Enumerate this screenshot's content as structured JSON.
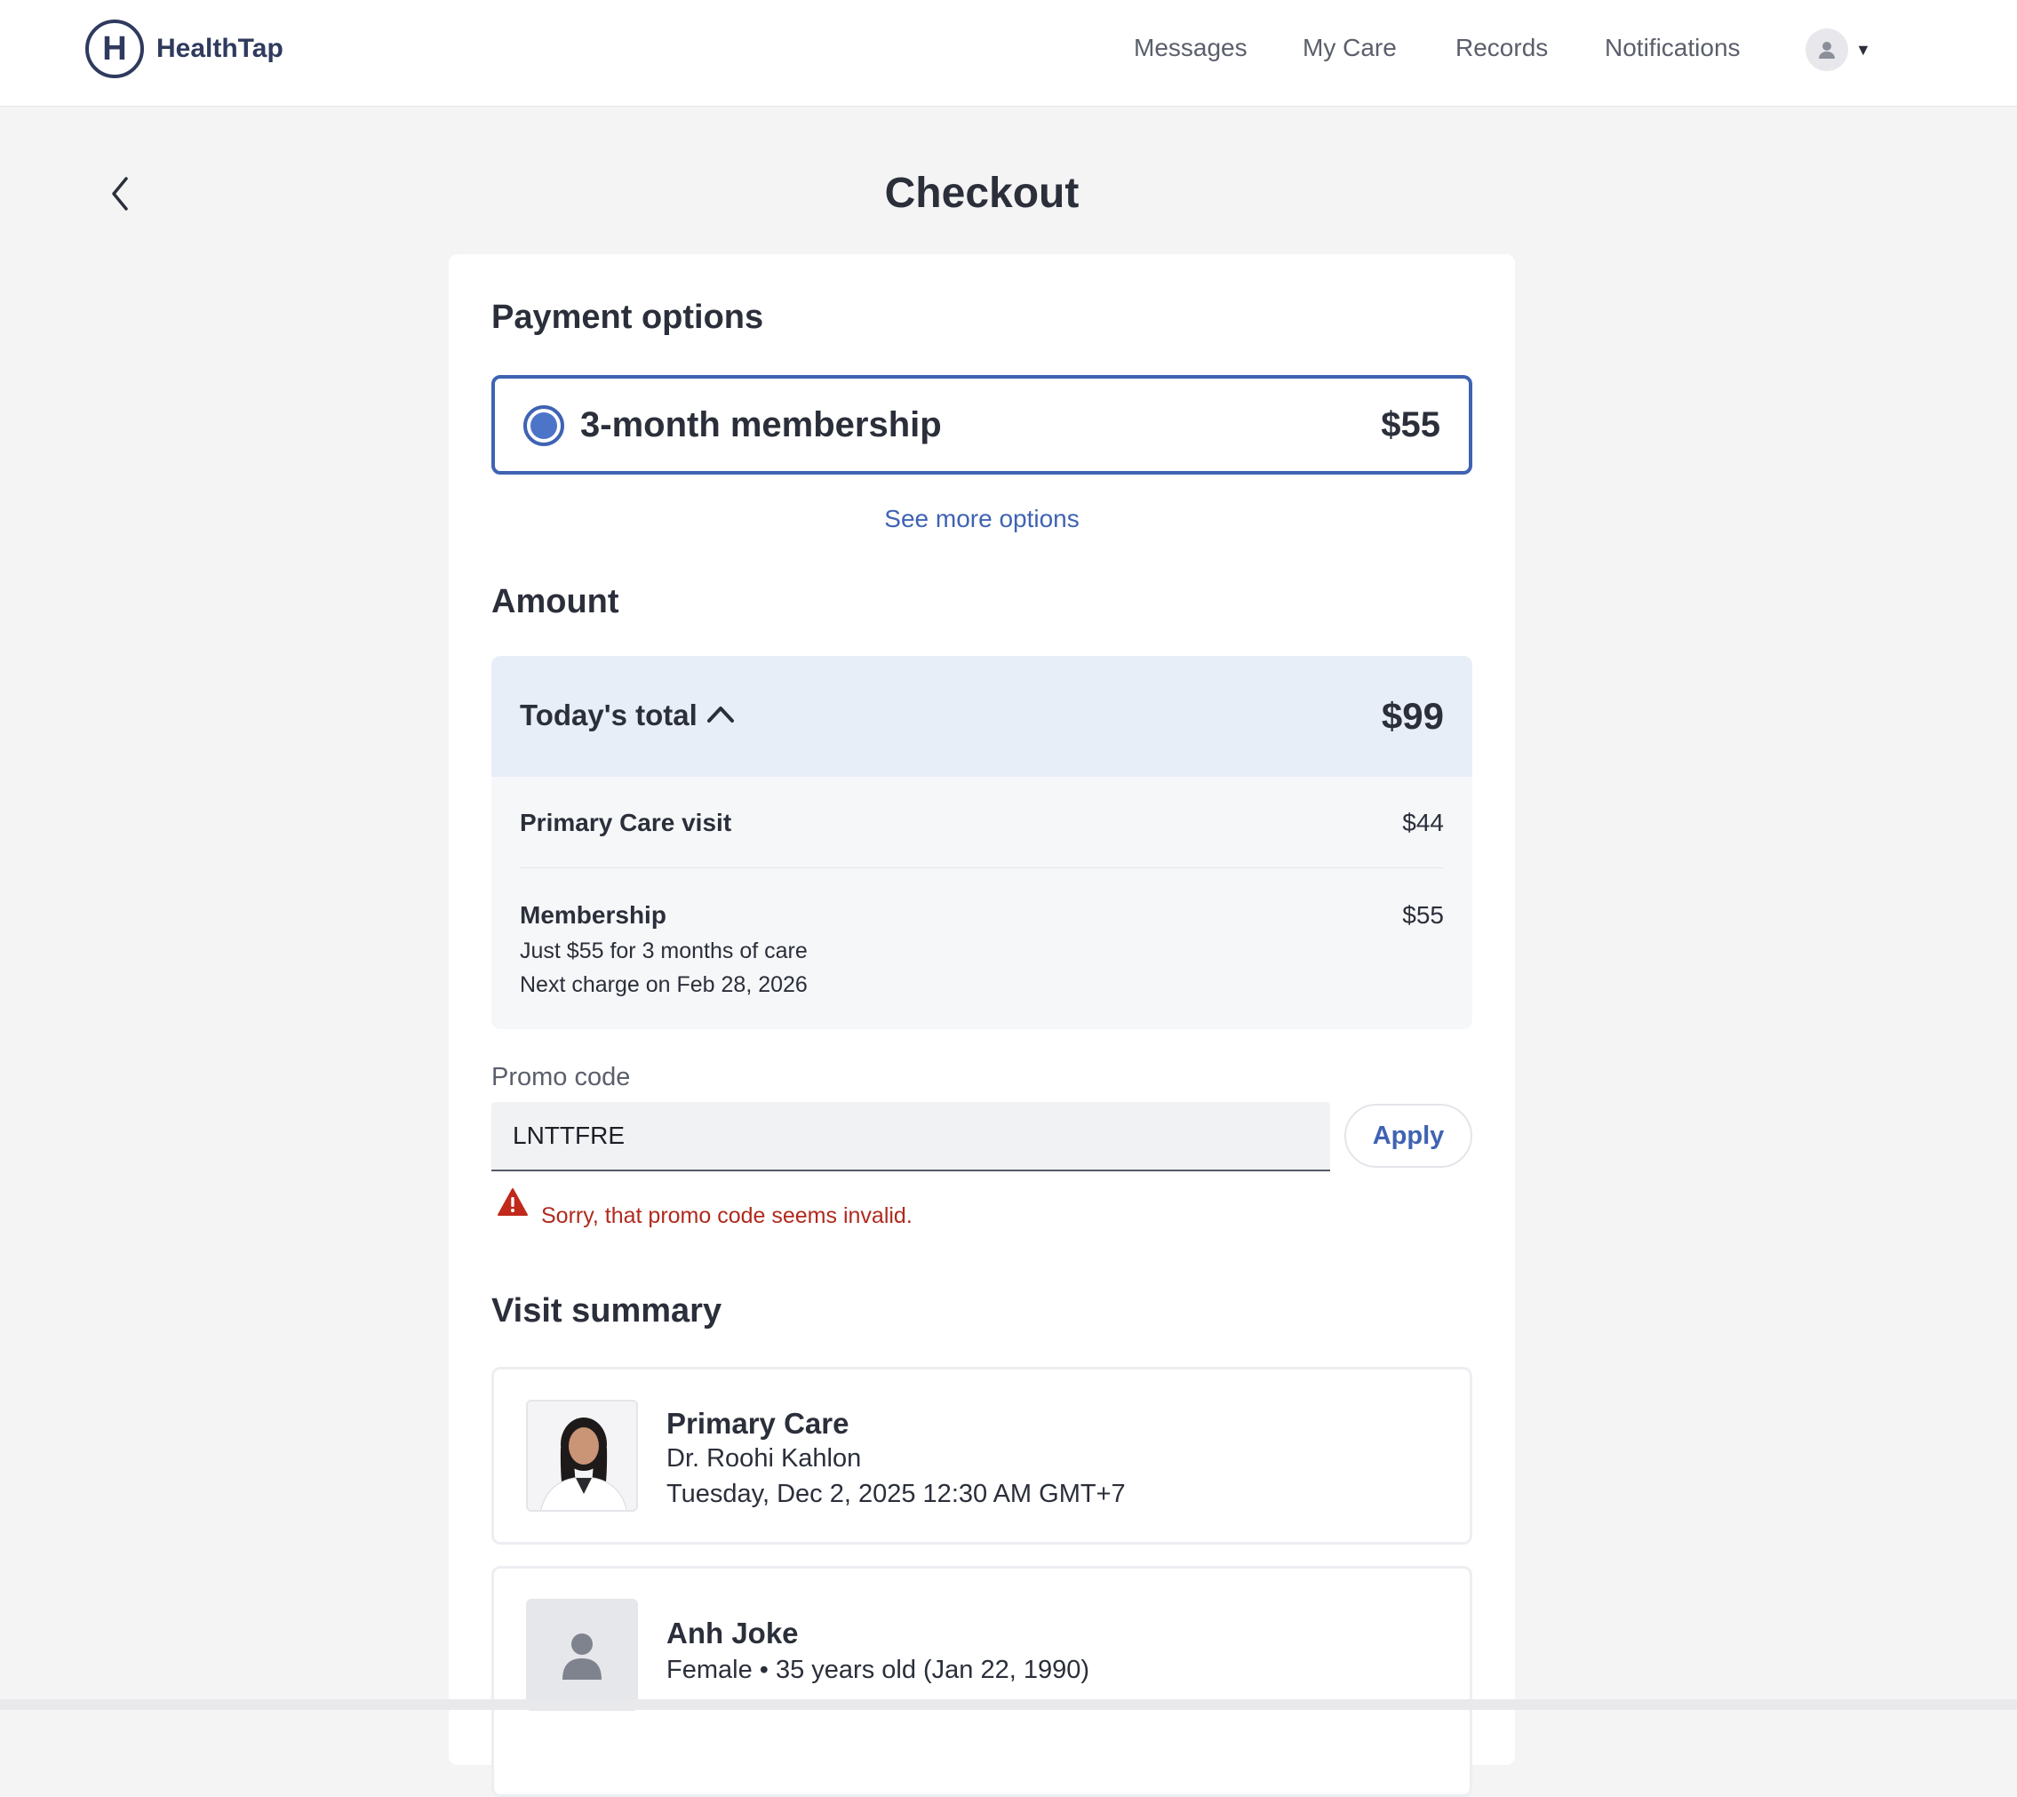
{
  "header": {
    "brand": "HealthTap",
    "nav": [
      "Messages",
      "My Care",
      "Records",
      "Notifications"
    ]
  },
  "page": {
    "title": "Checkout"
  },
  "payment": {
    "heading": "Payment options",
    "selected_plan": {
      "label": "3-month membership",
      "price": "$55"
    },
    "see_more": "See more options"
  },
  "amount": {
    "heading": "Amount",
    "total_label": "Today's total",
    "total": "$99",
    "items": [
      {
        "label": "Primary Care visit",
        "amount": "$44"
      },
      {
        "label": "Membership",
        "amount": "$55",
        "details": [
          "Just $55 for 3 months of care",
          "Next charge on Feb 28, 2026"
        ]
      }
    ]
  },
  "promo": {
    "label": "Promo code",
    "value": "LNTTFRE",
    "apply": "Apply",
    "error": "Sorry, that promo code seems invalid."
  },
  "visit_summary": {
    "heading": "Visit summary",
    "visit": {
      "type": "Primary Care",
      "doctor": "Dr. Roohi Kahlon",
      "datetime": "Tuesday, Dec 2, 2025 12:30 AM GMT+7"
    },
    "patient": {
      "name": "Anh Joke",
      "details": "Female • 35 years old (Jan 22, 1990)"
    }
  },
  "colors": {
    "accent": "#3f63b3",
    "error": "#b02a1e",
    "total_bg": "#e8eef8"
  },
  "icons": [
    "back-chevron-icon",
    "user-avatar-icon",
    "caret-down-icon",
    "chevron-up-icon",
    "warning-icon",
    "person-placeholder-icon"
  ]
}
